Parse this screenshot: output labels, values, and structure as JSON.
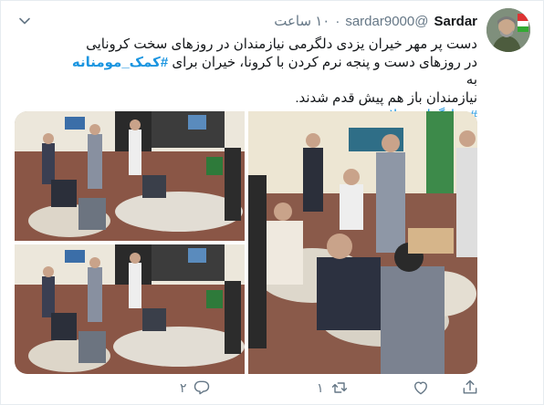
{
  "tweet": {
    "author_name": "Sardar",
    "author_handle": "@sardar9000",
    "separator": "·",
    "time": "۱۰ ساعت",
    "text_line1": "دست پر مهر خیران یزدی دلگرمی نیازمندان در روزهای سخت کرونایی",
    "text_line2_pre": "در روزهای دست و پنجه نرم کردن با کرونا، خیران برای ",
    "hashtag_main": "#کمک_مومنانه",
    "text_line2_post": " به",
    "text_line3": "نیازمندان باز هم پیش قدم شدند.",
    "hashtag_footer": "#جهادگران_سلامت_یزد"
  },
  "actions": {
    "reply_count": "۲",
    "retweet_count": "۱",
    "like_count": ""
  },
  "icons": {
    "caret": "chevron-down-icon",
    "reply": "reply-icon",
    "retweet": "retweet-icon",
    "like": "heart-icon",
    "share": "share-icon"
  },
  "colors": {
    "link": "#1b95e0",
    "muted": "#657786",
    "text": "#14171a"
  }
}
